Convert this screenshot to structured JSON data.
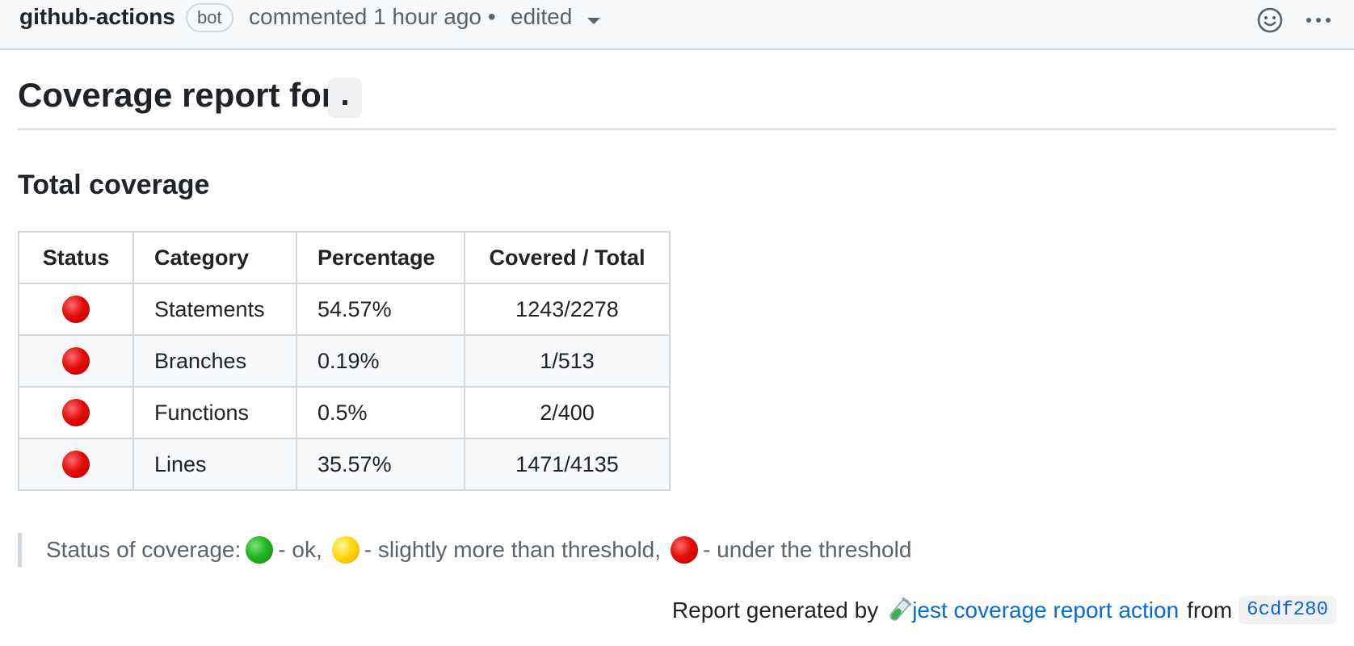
{
  "comment": {
    "author": "github-actions",
    "badge": "bot",
    "meta": "commented 1 hour ago •",
    "edited_label": "edited"
  },
  "report": {
    "heading_prefix": "Coverage report for",
    "heading_code": ".",
    "subheading": "Total coverage"
  },
  "table": {
    "headers": [
      "Status",
      "Category",
      "Percentage",
      "Covered / Total"
    ],
    "rows": [
      {
        "status": "red",
        "category": "Statements",
        "percentage": "54.57%",
        "covered": "1243/2278"
      },
      {
        "status": "red",
        "category": "Branches",
        "percentage": "0.19%",
        "covered": "1/513"
      },
      {
        "status": "red",
        "category": "Functions",
        "percentage": "0.5%",
        "covered": "2/400"
      },
      {
        "status": "red",
        "category": "Lines",
        "percentage": "35.57%",
        "covered": "1471/4135"
      }
    ]
  },
  "legend": {
    "prefix": "Status of coverage:",
    "ok": "- ok,",
    "slightly": "- slightly more than threshold,",
    "under": "- under the threshold"
  },
  "footer": {
    "prefix": "Report generated by",
    "link": "jest coverage report action",
    "from": "from",
    "sha": "6cdf280"
  },
  "icons": {
    "header_actions": [
      "smiley-icon",
      "kebab-menu-icon"
    ],
    "status_dot_colors": {
      "red": "#e30b0b",
      "yellow": "#ffd600",
      "green": "#22b522"
    },
    "footer_emoji": "test-tube-icon"
  },
  "colors": {
    "link": "#0969da",
    "muted": "#59636e",
    "header_bg": "#f6f8fa"
  }
}
